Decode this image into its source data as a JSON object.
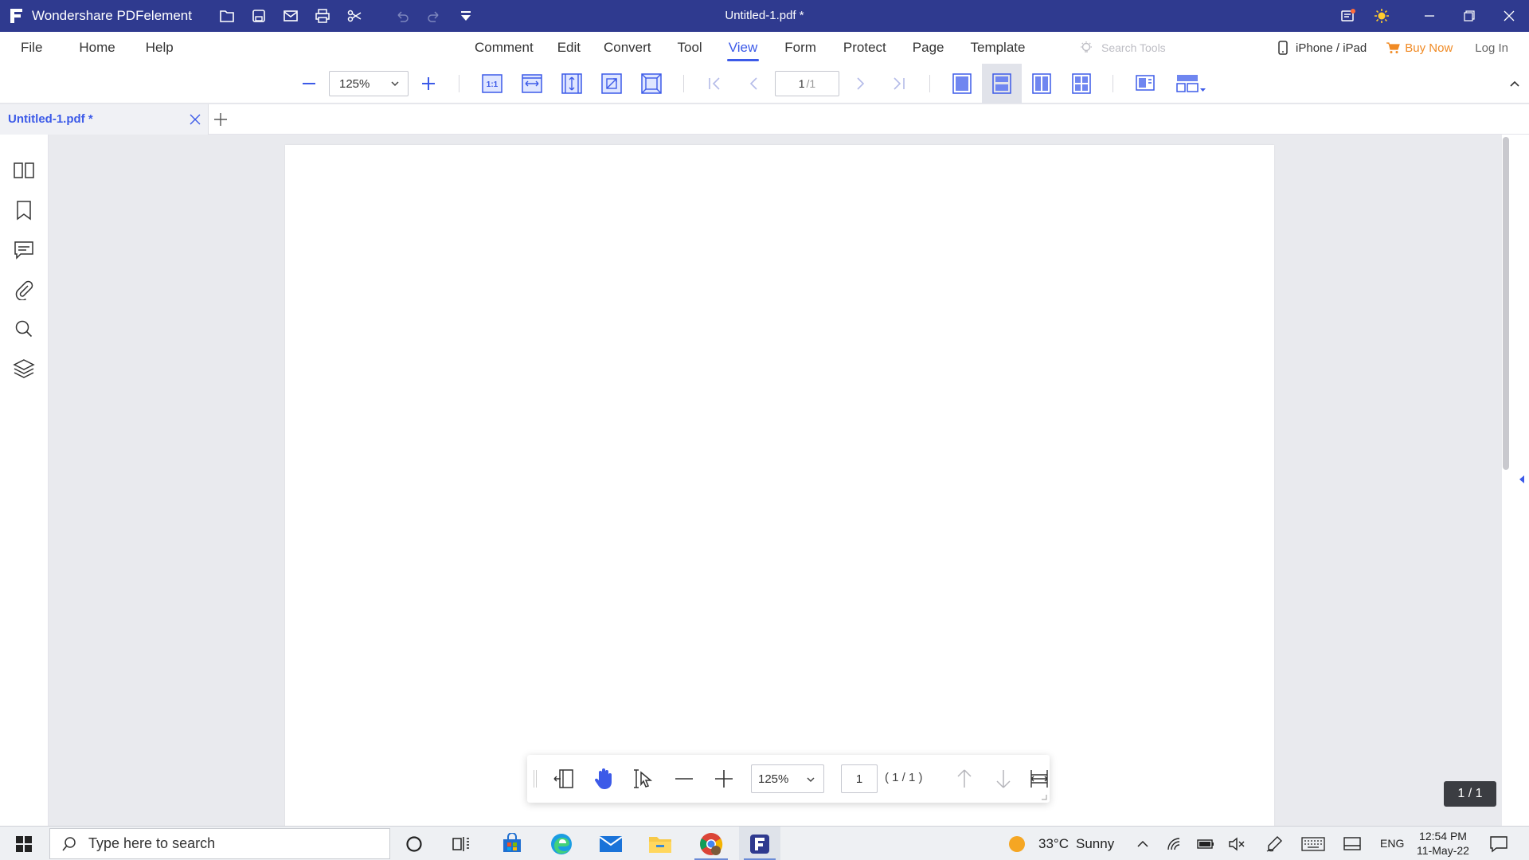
{
  "titlebar": {
    "app_name": "Wondershare PDFelement",
    "doc_title": "Untitled-1.pdf *",
    "bg_color": "#2f3a8f"
  },
  "menubar": {
    "left": [
      "File",
      "Home",
      "Help"
    ],
    "center": [
      "Comment",
      "Edit",
      "Convert",
      "Tool",
      "View",
      "Form",
      "Protect",
      "Page",
      "Template"
    ],
    "active": "View",
    "search_placeholder": "Search Tools",
    "device": "iPhone / iPad",
    "buy": "Buy Now",
    "login": "Log In",
    "accent_color": "#3c5ae8"
  },
  "toolbar": {
    "zoom": "125%",
    "page_current": "1",
    "page_total": "/1"
  },
  "tabs": [
    {
      "label": "Untitled-1.pdf *"
    }
  ],
  "floatbar": {
    "zoom": "125%",
    "page": "1",
    "total": "( 1 / 1 )"
  },
  "page_indicator": "1 / 1",
  "taskbar": {
    "search_placeholder": "Type here to search",
    "weather_temp": "33°C",
    "weather_desc": "Sunny",
    "lang": "ENG",
    "time": "12:54 PM",
    "date": "11-May-22"
  }
}
